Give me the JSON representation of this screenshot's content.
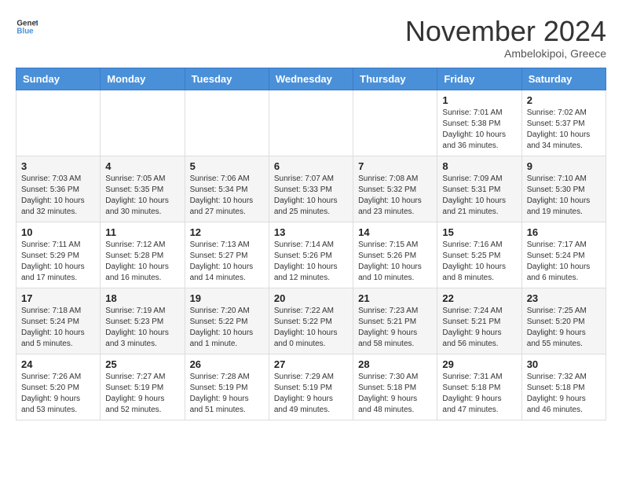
{
  "header": {
    "logo_line1": "General",
    "logo_line2": "Blue",
    "month": "November 2024",
    "location": "Ambelokipoi, Greece"
  },
  "weekdays": [
    "Sunday",
    "Monday",
    "Tuesday",
    "Wednesday",
    "Thursday",
    "Friday",
    "Saturday"
  ],
  "weeks": [
    [
      {
        "day": "",
        "info": ""
      },
      {
        "day": "",
        "info": ""
      },
      {
        "day": "",
        "info": ""
      },
      {
        "day": "",
        "info": ""
      },
      {
        "day": "",
        "info": ""
      },
      {
        "day": "1",
        "info": "Sunrise: 7:01 AM\nSunset: 5:38 PM\nDaylight: 10 hours and 36 minutes."
      },
      {
        "day": "2",
        "info": "Sunrise: 7:02 AM\nSunset: 5:37 PM\nDaylight: 10 hours and 34 minutes."
      }
    ],
    [
      {
        "day": "3",
        "info": "Sunrise: 7:03 AM\nSunset: 5:36 PM\nDaylight: 10 hours and 32 minutes."
      },
      {
        "day": "4",
        "info": "Sunrise: 7:05 AM\nSunset: 5:35 PM\nDaylight: 10 hours and 30 minutes."
      },
      {
        "day": "5",
        "info": "Sunrise: 7:06 AM\nSunset: 5:34 PM\nDaylight: 10 hours and 27 minutes."
      },
      {
        "day": "6",
        "info": "Sunrise: 7:07 AM\nSunset: 5:33 PM\nDaylight: 10 hours and 25 minutes."
      },
      {
        "day": "7",
        "info": "Sunrise: 7:08 AM\nSunset: 5:32 PM\nDaylight: 10 hours and 23 minutes."
      },
      {
        "day": "8",
        "info": "Sunrise: 7:09 AM\nSunset: 5:31 PM\nDaylight: 10 hours and 21 minutes."
      },
      {
        "day": "9",
        "info": "Sunrise: 7:10 AM\nSunset: 5:30 PM\nDaylight: 10 hours and 19 minutes."
      }
    ],
    [
      {
        "day": "10",
        "info": "Sunrise: 7:11 AM\nSunset: 5:29 PM\nDaylight: 10 hours and 17 minutes."
      },
      {
        "day": "11",
        "info": "Sunrise: 7:12 AM\nSunset: 5:28 PM\nDaylight: 10 hours and 16 minutes."
      },
      {
        "day": "12",
        "info": "Sunrise: 7:13 AM\nSunset: 5:27 PM\nDaylight: 10 hours and 14 minutes."
      },
      {
        "day": "13",
        "info": "Sunrise: 7:14 AM\nSunset: 5:26 PM\nDaylight: 10 hours and 12 minutes."
      },
      {
        "day": "14",
        "info": "Sunrise: 7:15 AM\nSunset: 5:26 PM\nDaylight: 10 hours and 10 minutes."
      },
      {
        "day": "15",
        "info": "Sunrise: 7:16 AM\nSunset: 5:25 PM\nDaylight: 10 hours and 8 minutes."
      },
      {
        "day": "16",
        "info": "Sunrise: 7:17 AM\nSunset: 5:24 PM\nDaylight: 10 hours and 6 minutes."
      }
    ],
    [
      {
        "day": "17",
        "info": "Sunrise: 7:18 AM\nSunset: 5:24 PM\nDaylight: 10 hours and 5 minutes."
      },
      {
        "day": "18",
        "info": "Sunrise: 7:19 AM\nSunset: 5:23 PM\nDaylight: 10 hours and 3 minutes."
      },
      {
        "day": "19",
        "info": "Sunrise: 7:20 AM\nSunset: 5:22 PM\nDaylight: 10 hours and 1 minute."
      },
      {
        "day": "20",
        "info": "Sunrise: 7:22 AM\nSunset: 5:22 PM\nDaylight: 10 hours and 0 minutes."
      },
      {
        "day": "21",
        "info": "Sunrise: 7:23 AM\nSunset: 5:21 PM\nDaylight: 9 hours and 58 minutes."
      },
      {
        "day": "22",
        "info": "Sunrise: 7:24 AM\nSunset: 5:21 PM\nDaylight: 9 hours and 56 minutes."
      },
      {
        "day": "23",
        "info": "Sunrise: 7:25 AM\nSunset: 5:20 PM\nDaylight: 9 hours and 55 minutes."
      }
    ],
    [
      {
        "day": "24",
        "info": "Sunrise: 7:26 AM\nSunset: 5:20 PM\nDaylight: 9 hours and 53 minutes."
      },
      {
        "day": "25",
        "info": "Sunrise: 7:27 AM\nSunset: 5:19 PM\nDaylight: 9 hours and 52 minutes."
      },
      {
        "day": "26",
        "info": "Sunrise: 7:28 AM\nSunset: 5:19 PM\nDaylight: 9 hours and 51 minutes."
      },
      {
        "day": "27",
        "info": "Sunrise: 7:29 AM\nSunset: 5:19 PM\nDaylight: 9 hours and 49 minutes."
      },
      {
        "day": "28",
        "info": "Sunrise: 7:30 AM\nSunset: 5:18 PM\nDaylight: 9 hours and 48 minutes."
      },
      {
        "day": "29",
        "info": "Sunrise: 7:31 AM\nSunset: 5:18 PM\nDaylight: 9 hours and 47 minutes."
      },
      {
        "day": "30",
        "info": "Sunrise: 7:32 AM\nSunset: 5:18 PM\nDaylight: 9 hours and 46 minutes."
      }
    ]
  ]
}
